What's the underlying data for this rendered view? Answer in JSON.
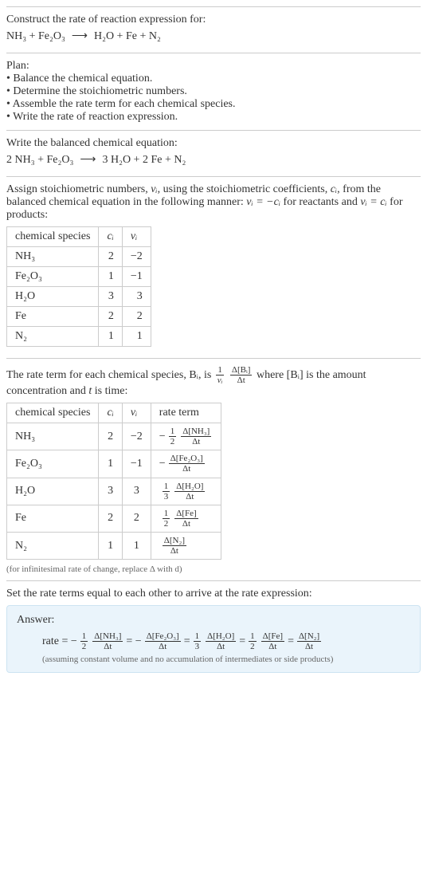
{
  "intro": {
    "line1": "Construct the rate of reaction expression for:",
    "eq_lhs": "NH₃ + Fe₂O₃",
    "arrow": "⟶",
    "eq_rhs": "H₂O + Fe + N₂"
  },
  "plan": {
    "title": "Plan:",
    "items": [
      "• Balance the chemical equation.",
      "• Determine the stoichiometric numbers.",
      "• Assemble the rate term for each chemical species.",
      "• Write the rate of reaction expression."
    ]
  },
  "balance": {
    "line1": "Write the balanced chemical equation:",
    "eq_lhs": "2 NH₃ + Fe₂O₃",
    "arrow": "⟶",
    "eq_rhs": "3 H₂O + 2 Fe + N₂"
  },
  "assign": {
    "text_pre": "Assign stoichiometric numbers, ",
    "nu_i": "νᵢ",
    "text_mid1": ", using the stoichiometric coefficients, ",
    "c_i": "cᵢ",
    "text_mid2": ", from the balanced chemical equation in the following manner: ",
    "rel1": "νᵢ = −cᵢ",
    "text_mid3": " for reactants and ",
    "rel2": "νᵢ = cᵢ",
    "text_end": " for products:",
    "headers": {
      "species": "chemical species",
      "c": "cᵢ",
      "nu": "νᵢ"
    },
    "rows": [
      {
        "species": "NH₃",
        "c": "2",
        "nu": "−2"
      },
      {
        "species": "Fe₂O₃",
        "c": "1",
        "nu": "−1"
      },
      {
        "species": "H₂O",
        "c": "3",
        "nu": "3"
      },
      {
        "species": "Fe",
        "c": "2",
        "nu": "2"
      },
      {
        "species": "N₂",
        "c": "1",
        "nu": "1"
      }
    ]
  },
  "rateterm": {
    "text_pre": "The rate term for each chemical species, Bᵢ, is ",
    "frac1_num": "1",
    "frac1_den": "νᵢ",
    "frac2_num": "Δ[Bᵢ]",
    "frac2_den": "Δt",
    "text_mid": " where [Bᵢ] is the amount concentration and ",
    "t": "t",
    "text_end": " is time:",
    "headers": {
      "species": "chemical species",
      "c": "cᵢ",
      "nu": "νᵢ",
      "rate": "rate term"
    },
    "rows": [
      {
        "species": "NH₃",
        "c": "2",
        "nu": "−2",
        "pre": "−",
        "fnum": "1",
        "fden": "2",
        "gnum": "Δ[NH₃]",
        "gden": "Δt"
      },
      {
        "species": "Fe₂O₃",
        "c": "1",
        "nu": "−1",
        "pre": "−",
        "fnum": "",
        "fden": "",
        "gnum": "Δ[Fe₂O₃]",
        "gden": "Δt"
      },
      {
        "species": "H₂O",
        "c": "3",
        "nu": "3",
        "pre": "",
        "fnum": "1",
        "fden": "3",
        "gnum": "Δ[H₂O]",
        "gden": "Δt"
      },
      {
        "species": "Fe",
        "c": "2",
        "nu": "2",
        "pre": "",
        "fnum": "1",
        "fden": "2",
        "gnum": "Δ[Fe]",
        "gden": "Δt"
      },
      {
        "species": "N₂",
        "c": "1",
        "nu": "1",
        "pre": "",
        "fnum": "",
        "fden": "",
        "gnum": "Δ[N₂]",
        "gden": "Δt"
      }
    ],
    "footnote": "(for infinitesimal rate of change, replace Δ with d)"
  },
  "final": {
    "text": "Set the rate terms equal to each other to arrive at the rate expression:"
  },
  "answer": {
    "label": "Answer:",
    "prefix": "rate = −",
    "terms": [
      {
        "fnum": "1",
        "fden": "2",
        "gnum": "Δ[NH₃]",
        "gden": "Δt",
        "after": " = −"
      },
      {
        "fnum": "",
        "fden": "",
        "gnum": "Δ[Fe₂O₃]",
        "gden": "Δt",
        "after": " = "
      },
      {
        "fnum": "1",
        "fden": "3",
        "gnum": "Δ[H₂O]",
        "gden": "Δt",
        "after": " = "
      },
      {
        "fnum": "1",
        "fden": "2",
        "gnum": "Δ[Fe]",
        "gden": "Δt",
        "after": " = "
      },
      {
        "fnum": "",
        "fden": "",
        "gnum": "Δ[N₂]",
        "gden": "Δt",
        "after": ""
      }
    ],
    "footnote": "(assuming constant volume and no accumulation of intermediates or side products)"
  }
}
